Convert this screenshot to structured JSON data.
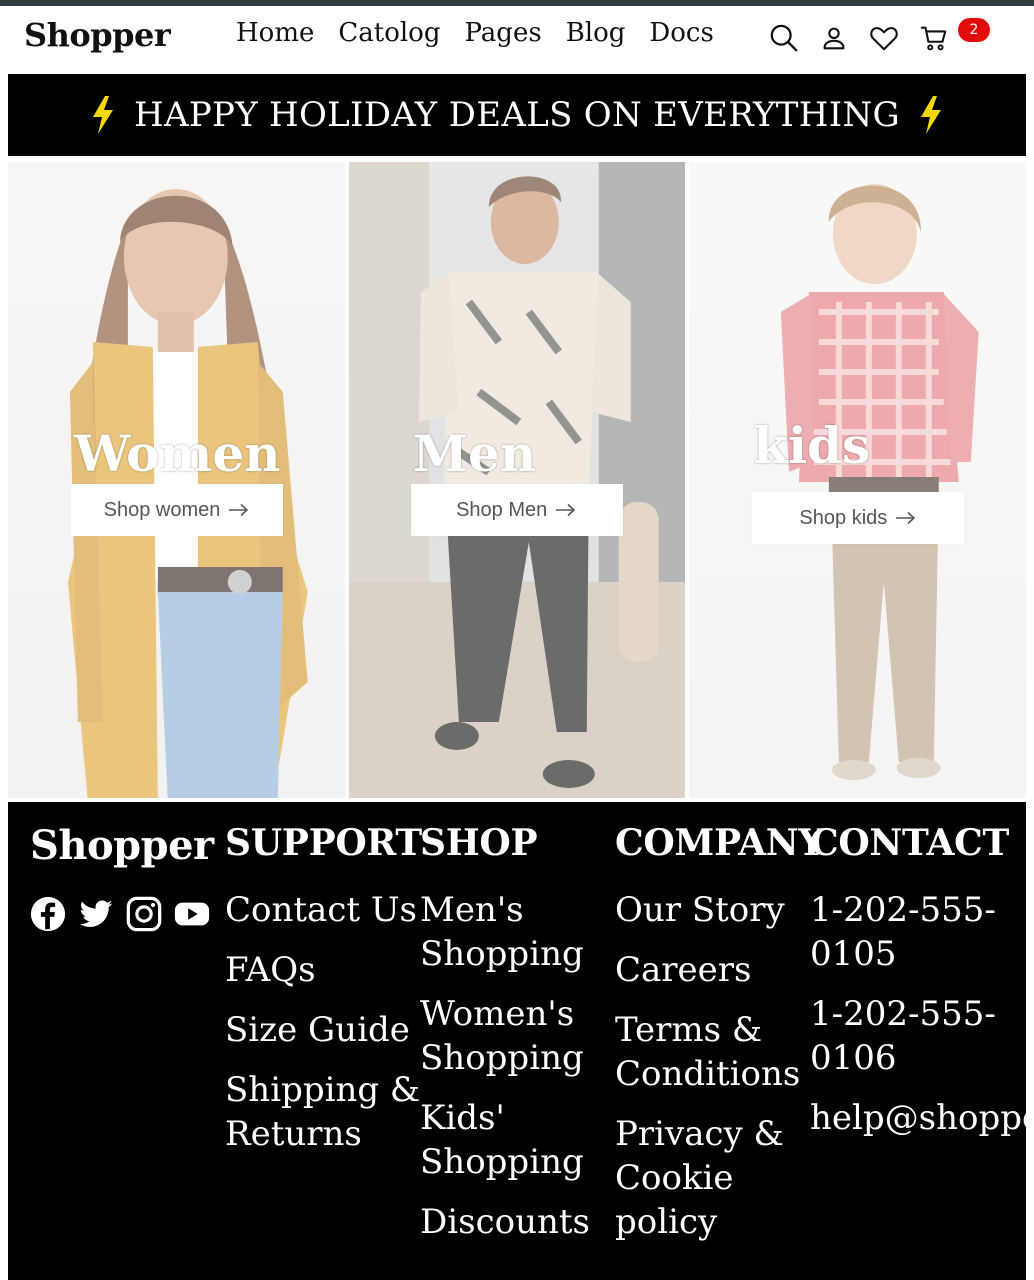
{
  "brand": "Shopper",
  "nav": {
    "links": [
      "Home",
      "Catolog",
      "Pages",
      "Blog",
      "Docs"
    ],
    "icons": [
      "search-icon",
      "user-icon",
      "heart-icon",
      "cart-icon"
    ],
    "cart_count": "2"
  },
  "promo": {
    "text": "HAPPY HOLIDAY DEALS ON EVERYTHING",
    "accent_color": "#f5d800"
  },
  "categories": [
    {
      "title": "Women",
      "button": "Shop women"
    },
    {
      "title": "Men",
      "button": "Shop Men"
    },
    {
      "title": "kids",
      "button": "Shop kids"
    }
  ],
  "footer": {
    "brand": "Shopper",
    "socials": [
      "facebook-icon",
      "twitter-icon",
      "instagram-icon",
      "youtube-icon"
    ],
    "support": {
      "heading": "SUPPORT",
      "links": [
        "Contact Us",
        "FAQs",
        "Size Guide",
        "Shipping & Returns"
      ]
    },
    "shop": {
      "heading": "SHOP",
      "links": [
        "Men's Shopping",
        "Women's Shopping",
        "Kids' Shopping",
        "Discounts"
      ]
    },
    "company": {
      "heading": "COMPANY",
      "links": [
        "Our Story",
        "Careers",
        "Terms & Conditions",
        "Privacy & Cookie policy"
      ]
    },
    "contact": {
      "heading": "CONTACT",
      "links": [
        "1-202-555-0105",
        "1-202-555-0106",
        "help@shopper.com"
      ]
    }
  },
  "colors": {
    "badge": "#e30b0b",
    "footer_bg": "#000000",
    "promo_bg": "#000000"
  }
}
